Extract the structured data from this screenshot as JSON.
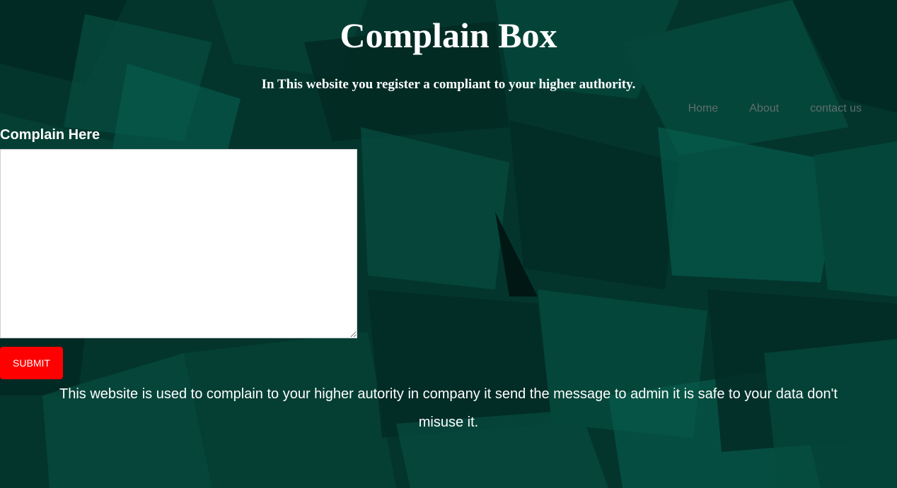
{
  "header": {
    "title": "Complain Box",
    "subtitle": "In This website you register a compliant to your higher authority."
  },
  "nav": {
    "items": [
      {
        "label": "Home"
      },
      {
        "label": "About"
      },
      {
        "label": "contact us"
      }
    ]
  },
  "form": {
    "label": "Complain Here",
    "complaint_value": "",
    "submit_label": "SUBMIT"
  },
  "footer": {
    "text": "This website is used to complain to your higher autority in company it send the message to admin it is safe to your data don't misuse it."
  },
  "colors": {
    "background": "#03352d",
    "submit": "#ff0000",
    "nav_text": "#5f6e69",
    "text": "#ffffff"
  }
}
